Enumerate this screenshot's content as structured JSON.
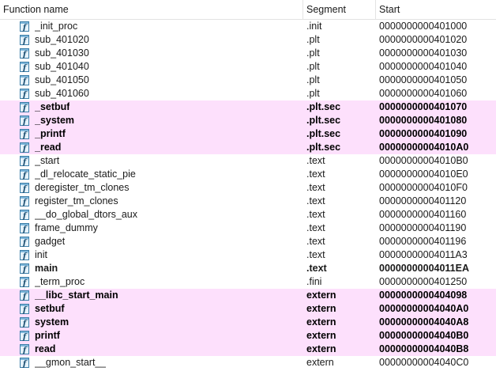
{
  "header": {
    "function_name": "Function name",
    "segment": "Segment",
    "start": "Start"
  },
  "icon": {
    "name": "function-icon",
    "glyph": "f",
    "border_color": "#3b7ea8",
    "fill_color": "#e6f3fb",
    "stripe_color": "#7fb7da"
  },
  "colors": {
    "highlight_bg": "#fde0fc"
  },
  "rows": [
    {
      "name": "_init_proc",
      "segment": ".init",
      "start": "0000000000401000",
      "style": "normal"
    },
    {
      "name": "sub_401020",
      "segment": ".plt",
      "start": "0000000000401020",
      "style": "normal"
    },
    {
      "name": "sub_401030",
      "segment": ".plt",
      "start": "0000000000401030",
      "style": "normal"
    },
    {
      "name": "sub_401040",
      "segment": ".plt",
      "start": "0000000000401040",
      "style": "normal"
    },
    {
      "name": "sub_401050",
      "segment": ".plt",
      "start": "0000000000401050",
      "style": "normal"
    },
    {
      "name": "sub_401060",
      "segment": ".plt",
      "start": "0000000000401060",
      "style": "normal"
    },
    {
      "name": "_setbuf",
      "segment": ".plt.sec",
      "start": "0000000000401070",
      "style": "highlight"
    },
    {
      "name": "_system",
      "segment": ".plt.sec",
      "start": "0000000000401080",
      "style": "highlight"
    },
    {
      "name": "_printf",
      "segment": ".plt.sec",
      "start": "0000000000401090",
      "style": "highlight"
    },
    {
      "name": "_read",
      "segment": ".plt.sec",
      "start": "00000000004010A0",
      "style": "highlight"
    },
    {
      "name": "_start",
      "segment": ".text",
      "start": "00000000004010B0",
      "style": "normal"
    },
    {
      "name": "_dl_relocate_static_pie",
      "segment": ".text",
      "start": "00000000004010E0",
      "style": "normal"
    },
    {
      "name": "deregister_tm_clones",
      "segment": ".text",
      "start": "00000000004010F0",
      "style": "normal"
    },
    {
      "name": "register_tm_clones",
      "segment": ".text",
      "start": "0000000000401120",
      "style": "normal"
    },
    {
      "name": "__do_global_dtors_aux",
      "segment": ".text",
      "start": "0000000000401160",
      "style": "normal"
    },
    {
      "name": "frame_dummy",
      "segment": ".text",
      "start": "0000000000401190",
      "style": "normal"
    },
    {
      "name": "gadget",
      "segment": ".text",
      "start": "0000000000401196",
      "style": "normal"
    },
    {
      "name": "init",
      "segment": ".text",
      "start": "00000000004011A3",
      "style": "normal"
    },
    {
      "name": "main",
      "segment": ".text",
      "start": "00000000004011EA",
      "style": "bold"
    },
    {
      "name": "_term_proc",
      "segment": ".fini",
      "start": "0000000000401250",
      "style": "normal"
    },
    {
      "name": "__libc_start_main",
      "segment": "extern",
      "start": "0000000000404098",
      "style": "highlight"
    },
    {
      "name": "setbuf",
      "segment": "extern",
      "start": "00000000004040A0",
      "style": "highlight"
    },
    {
      "name": "system",
      "segment": "extern",
      "start": "00000000004040A8",
      "style": "highlight"
    },
    {
      "name": "printf",
      "segment": "extern",
      "start": "00000000004040B0",
      "style": "highlight"
    },
    {
      "name": "read",
      "segment": "extern",
      "start": "00000000004040B8",
      "style": "highlight"
    },
    {
      "name": "__gmon_start__",
      "segment": "extern",
      "start": "00000000004040C0",
      "style": "normal"
    }
  ]
}
